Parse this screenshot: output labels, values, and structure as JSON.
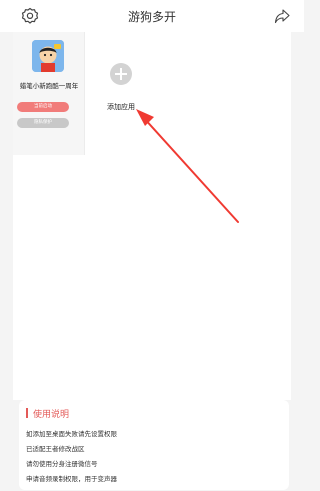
{
  "header": {
    "title": "游狗多开",
    "left_icon": "gear-icon",
    "right_icon": "share-icon"
  },
  "apps": [
    {
      "name": "蜡笔小新跑酷一周年",
      "icon": "crayon-shinchan-app-icon",
      "launch_label": "当前启动",
      "protect_label": "隐私保护"
    }
  ],
  "add_app": {
    "label": "添加应用",
    "icon": "plus-circle-icon"
  },
  "annotation": {
    "color": "#f03a32"
  },
  "help": {
    "title": "使用说明",
    "lines": [
      "如添加至桌面失败请先设置权限",
      "已适配王者修改战区",
      "请勿使用分身注册微信号",
      "申请音频录制权限，用于变声器"
    ]
  },
  "colors": {
    "accent": "#e35a58",
    "launch_button": "#f17c7a",
    "protect_button": "#c8c8c8"
  }
}
